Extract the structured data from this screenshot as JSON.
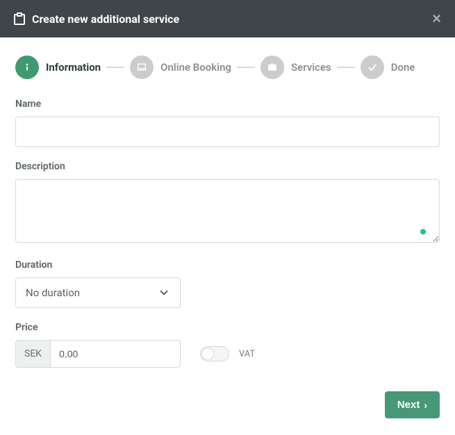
{
  "header": {
    "title": "Create new additional service"
  },
  "stepper": {
    "steps": [
      {
        "label": "Information"
      },
      {
        "label": "Online Booking"
      },
      {
        "label": "Services"
      },
      {
        "label": "Done"
      }
    ]
  },
  "form": {
    "name_label": "Name",
    "name_value": "",
    "description_label": "Description",
    "description_value": "",
    "duration_label": "Duration",
    "duration_selected": "No duration",
    "price_label": "Price",
    "currency": "SEK",
    "price_value": "0,00",
    "vat_label": "VAT",
    "vat_on": false
  },
  "footer": {
    "next_label": "Next"
  }
}
